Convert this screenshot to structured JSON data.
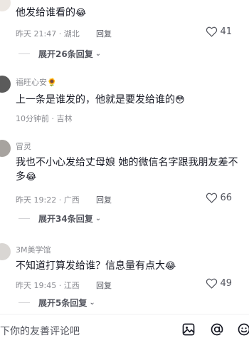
{
  "comments": [
    {
      "username": "",
      "text": "他发给谁看的",
      "emoji": "😂",
      "time": "昨天 21:47",
      "location": "湖北",
      "reply": "回复",
      "likes": "41",
      "expand": "展开26条回复"
    },
    {
      "username": "福旺心安",
      "user_emoji": "🌻",
      "text": "上一条是谁发的，他就是要发给谁的",
      "emoji": "😳",
      "time": "10分钟前",
      "location": "吉林",
      "reply": "回复"
    },
    {
      "username": "冒灵",
      "text_line1": "我也不小心发给丈母娘 她的微信名字跟我朋友差不",
      "text_line2": "多",
      "emoji": "😂",
      "time": "昨天 19:22",
      "location": "广西",
      "reply": "回复",
      "likes": "66",
      "expand": "展开34条回复"
    },
    {
      "username": "3M美学馆",
      "text": "不知道打算发给谁？信息量有点大",
      "emoji": "😂",
      "time": "昨天 19:45",
      "location": "江西",
      "reply": "回复",
      "likes": "49",
      "expand": "展开5条回复"
    }
  ],
  "input": {
    "placeholder": "下你的友善评论吧"
  },
  "icons": [
    "image-icon",
    "at-icon",
    "emoji-icon",
    "heart-outline-icon",
    "chevron-down-icon"
  ]
}
